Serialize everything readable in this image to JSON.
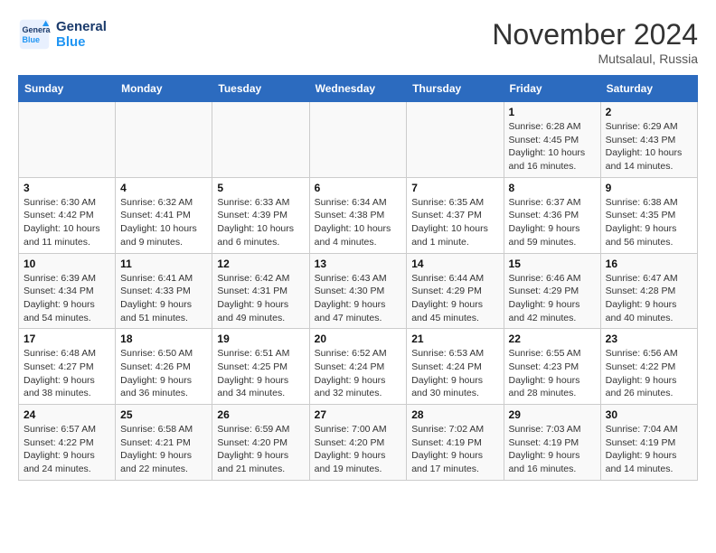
{
  "header": {
    "logo_line1": "General",
    "logo_line2": "Blue",
    "month": "November 2024",
    "location": "Mutsalaul, Russia"
  },
  "weekdays": [
    "Sunday",
    "Monday",
    "Tuesday",
    "Wednesday",
    "Thursday",
    "Friday",
    "Saturday"
  ],
  "weeks": [
    [
      {
        "day": "",
        "info": ""
      },
      {
        "day": "",
        "info": ""
      },
      {
        "day": "",
        "info": ""
      },
      {
        "day": "",
        "info": ""
      },
      {
        "day": "",
        "info": ""
      },
      {
        "day": "1",
        "info": "Sunrise: 6:28 AM\nSunset: 4:45 PM\nDaylight: 10 hours and 16 minutes."
      },
      {
        "day": "2",
        "info": "Sunrise: 6:29 AM\nSunset: 4:43 PM\nDaylight: 10 hours and 14 minutes."
      }
    ],
    [
      {
        "day": "3",
        "info": "Sunrise: 6:30 AM\nSunset: 4:42 PM\nDaylight: 10 hours and 11 minutes."
      },
      {
        "day": "4",
        "info": "Sunrise: 6:32 AM\nSunset: 4:41 PM\nDaylight: 10 hours and 9 minutes."
      },
      {
        "day": "5",
        "info": "Sunrise: 6:33 AM\nSunset: 4:39 PM\nDaylight: 10 hours and 6 minutes."
      },
      {
        "day": "6",
        "info": "Sunrise: 6:34 AM\nSunset: 4:38 PM\nDaylight: 10 hours and 4 minutes."
      },
      {
        "day": "7",
        "info": "Sunrise: 6:35 AM\nSunset: 4:37 PM\nDaylight: 10 hours and 1 minute."
      },
      {
        "day": "8",
        "info": "Sunrise: 6:37 AM\nSunset: 4:36 PM\nDaylight: 9 hours and 59 minutes."
      },
      {
        "day": "9",
        "info": "Sunrise: 6:38 AM\nSunset: 4:35 PM\nDaylight: 9 hours and 56 minutes."
      }
    ],
    [
      {
        "day": "10",
        "info": "Sunrise: 6:39 AM\nSunset: 4:34 PM\nDaylight: 9 hours and 54 minutes."
      },
      {
        "day": "11",
        "info": "Sunrise: 6:41 AM\nSunset: 4:33 PM\nDaylight: 9 hours and 51 minutes."
      },
      {
        "day": "12",
        "info": "Sunrise: 6:42 AM\nSunset: 4:31 PM\nDaylight: 9 hours and 49 minutes."
      },
      {
        "day": "13",
        "info": "Sunrise: 6:43 AM\nSunset: 4:30 PM\nDaylight: 9 hours and 47 minutes."
      },
      {
        "day": "14",
        "info": "Sunrise: 6:44 AM\nSunset: 4:29 PM\nDaylight: 9 hours and 45 minutes."
      },
      {
        "day": "15",
        "info": "Sunrise: 6:46 AM\nSunset: 4:29 PM\nDaylight: 9 hours and 42 minutes."
      },
      {
        "day": "16",
        "info": "Sunrise: 6:47 AM\nSunset: 4:28 PM\nDaylight: 9 hours and 40 minutes."
      }
    ],
    [
      {
        "day": "17",
        "info": "Sunrise: 6:48 AM\nSunset: 4:27 PM\nDaylight: 9 hours and 38 minutes."
      },
      {
        "day": "18",
        "info": "Sunrise: 6:50 AM\nSunset: 4:26 PM\nDaylight: 9 hours and 36 minutes."
      },
      {
        "day": "19",
        "info": "Sunrise: 6:51 AM\nSunset: 4:25 PM\nDaylight: 9 hours and 34 minutes."
      },
      {
        "day": "20",
        "info": "Sunrise: 6:52 AM\nSunset: 4:24 PM\nDaylight: 9 hours and 32 minutes."
      },
      {
        "day": "21",
        "info": "Sunrise: 6:53 AM\nSunset: 4:24 PM\nDaylight: 9 hours and 30 minutes."
      },
      {
        "day": "22",
        "info": "Sunrise: 6:55 AM\nSunset: 4:23 PM\nDaylight: 9 hours and 28 minutes."
      },
      {
        "day": "23",
        "info": "Sunrise: 6:56 AM\nSunset: 4:22 PM\nDaylight: 9 hours and 26 minutes."
      }
    ],
    [
      {
        "day": "24",
        "info": "Sunrise: 6:57 AM\nSunset: 4:22 PM\nDaylight: 9 hours and 24 minutes."
      },
      {
        "day": "25",
        "info": "Sunrise: 6:58 AM\nSunset: 4:21 PM\nDaylight: 9 hours and 22 minutes."
      },
      {
        "day": "26",
        "info": "Sunrise: 6:59 AM\nSunset: 4:20 PM\nDaylight: 9 hours and 21 minutes."
      },
      {
        "day": "27",
        "info": "Sunrise: 7:00 AM\nSunset: 4:20 PM\nDaylight: 9 hours and 19 minutes."
      },
      {
        "day": "28",
        "info": "Sunrise: 7:02 AM\nSunset: 4:19 PM\nDaylight: 9 hours and 17 minutes."
      },
      {
        "day": "29",
        "info": "Sunrise: 7:03 AM\nSunset: 4:19 PM\nDaylight: 9 hours and 16 minutes."
      },
      {
        "day": "30",
        "info": "Sunrise: 7:04 AM\nSunset: 4:19 PM\nDaylight: 9 hours and 14 minutes."
      }
    ]
  ]
}
